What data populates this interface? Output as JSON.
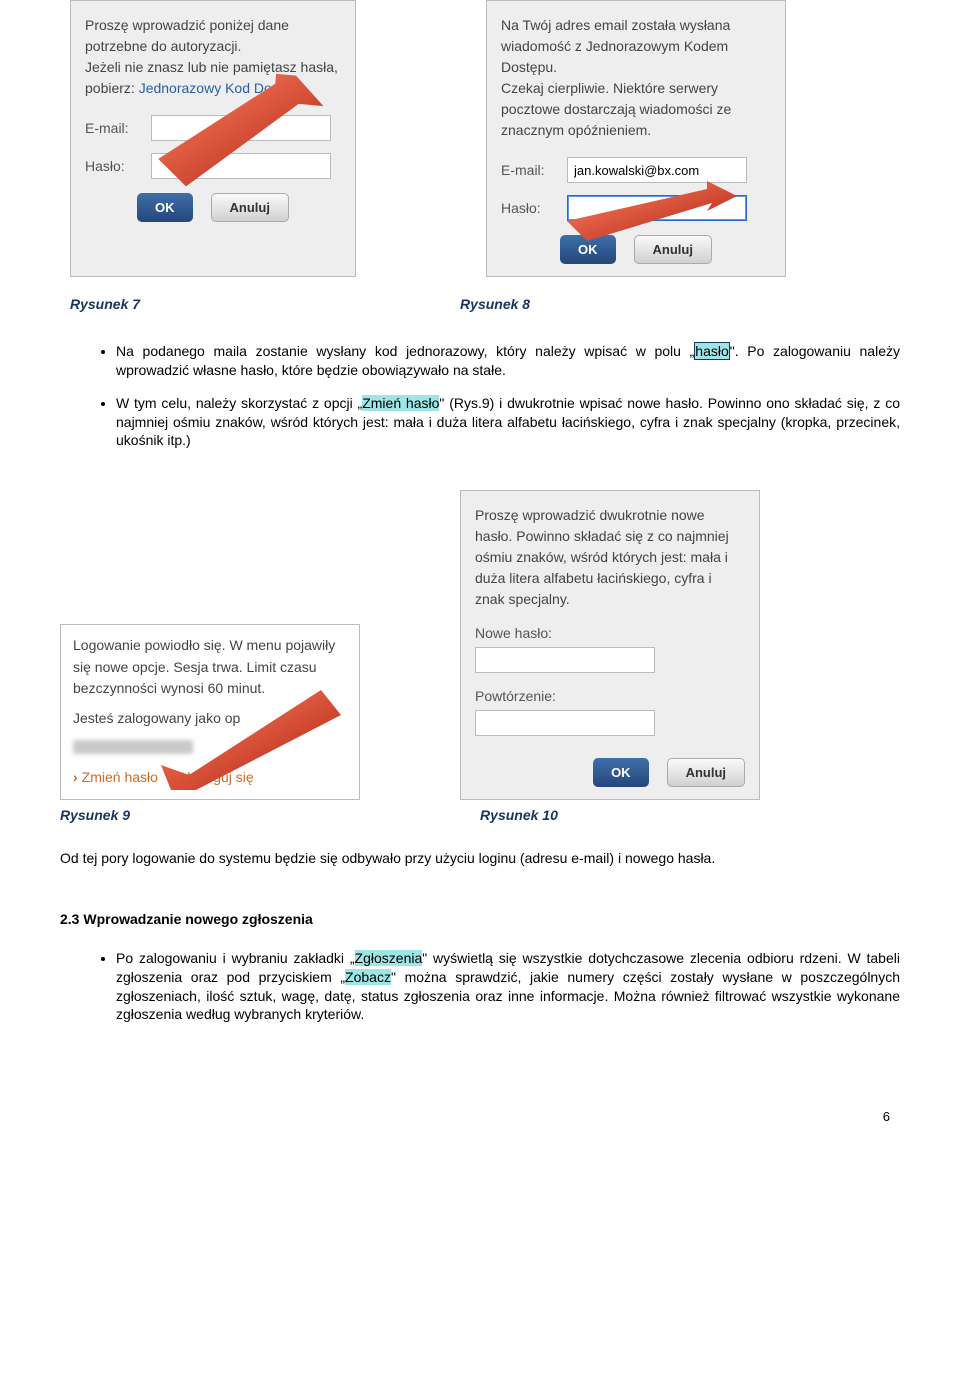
{
  "dialog7": {
    "intro1": "Proszę wprowadzić poniżej dane potrzebne do autoryzacji.",
    "intro2a": "Jeżeli nie znasz lub nie pamiętasz hasła, pobierz: ",
    "intro2link": "Jednorazowy Kod Dostępu",
    "intro2b": ".",
    "email_label": "E-mail:",
    "email_value": "",
    "password_label": "Hasło:",
    "password_value": "",
    "ok": "OK",
    "cancel": "Anuluj"
  },
  "dialog8": {
    "intro1": "Na Twój adres email została wysłana wiadomość z Jednorazowym Kodem Dostępu.",
    "intro2": "Czekaj cierpliwie. Niektóre serwery pocztowe dostarczają wiadomości ze znacznym opóźnieniem.",
    "email_label": "E-mail:",
    "email_value": "jan.kowalski@bx.com",
    "password_label": "Hasło:",
    "password_value": "",
    "ok": "OK",
    "cancel": "Anuluj"
  },
  "caption7": "Rysunek 7",
  "caption8": "Rysunek 8",
  "bullets": {
    "b1a": "Na podanego maila zostanie wysłany kod jednorazowy, który należy wpisać w polu „",
    "b1h": "hasło",
    "b1b": "\". Po zalogowaniu należy wprowadzić własne hasło, które będzie obowiązywało na stałe.",
    "b2a": "W tym celu, należy skorzystać z opcji „",
    "b2h": "Zmień hasło",
    "b2b": "\" (Rys.9) i dwukrotnie wpisać nowe hasło. Powinno ono składać się, z co najmniej ośmiu znaków, wśród których jest: mała i duża litera alfabetu łacińskiego, cyfra i znak specjalny (kropka, przecinek, ukośnik itp.)"
  },
  "dialog9": {
    "line1": "Logowanie powiodło się. W menu pojawiły się nowe opcje. Sesja trwa. Limit czasu bezczynności wynosi 60 minut.",
    "line2a": "Jesteś zalogowany jako op",
    "line2b": "tor",
    "link1": "Zmień hasło",
    "link2": "Wyloguj się"
  },
  "dialog10": {
    "intro": "Proszę wprowadzić dwukrotnie nowe hasło. Powinno składać się z co najmniej ośmiu znaków, wśród których jest: mała i duża litera alfabetu łacińskiego, cyfra i znak specjalny.",
    "new_label": "Nowe hasło:",
    "repeat_label": "Powtórzenie:",
    "ok": "OK",
    "cancel": "Anuluj"
  },
  "caption9": "Rysunek 9",
  "caption10": "Rysunek 10",
  "para_after": "Od tej pory logowanie do systemu będzie się odbywało przy użyciu loginu (adresu e-mail) i nowego hasła.",
  "section23": "2.3 Wprowadzanie nowego zgłoszenia",
  "bullet3": {
    "a": "Po zalogowaniu i wybraniu zakładki „",
    "h1": "Zgłoszenia",
    "b": "\" wyświetlą się wszystkie dotychczasowe zlecenia odbioru rdzeni. W tabeli zgłoszenia oraz pod przyciskiem „",
    "h2": "Zobacz",
    "c": "\" można sprawdzić, jakie numery części zostały wysłane w poszczególnych zgłoszeniach, ilość sztuk, wagę, datę, status zgłoszenia oraz inne informacje. Można również filtrować wszystkie wykonane zgłoszenia według wybranych kryteriów."
  },
  "pagenum": "6"
}
